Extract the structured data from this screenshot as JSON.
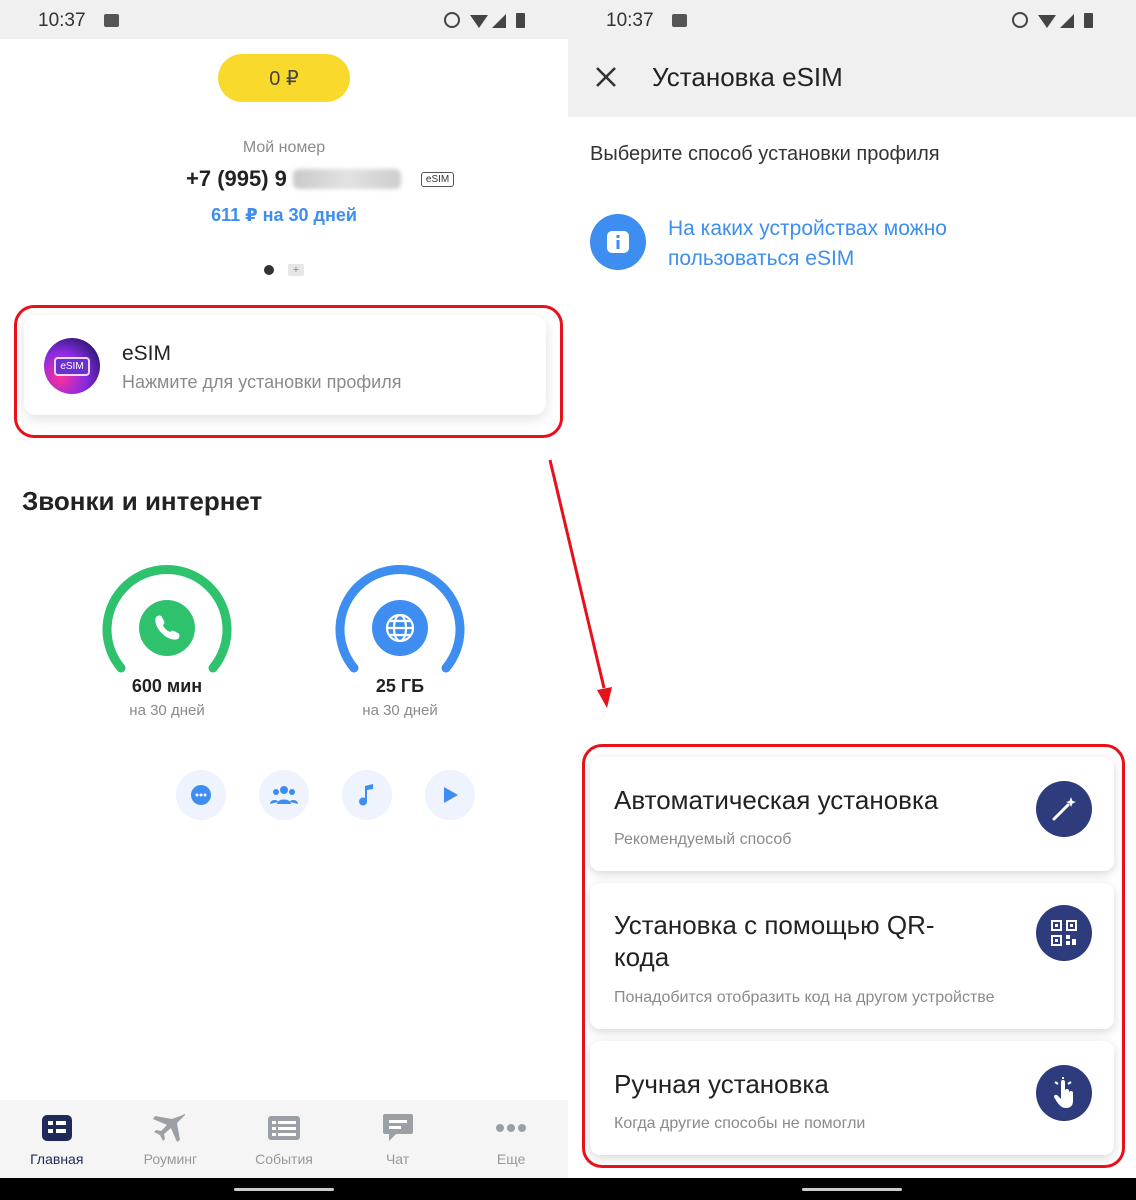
{
  "left": {
    "status": {
      "time": "10:37"
    },
    "balance": "0 ₽",
    "my_number_label": "Мой номер",
    "phone_visible": "+7 (995) 9",
    "esim_chip": "eSIM",
    "tariff": "611 ₽ на 30 дней",
    "esim_card": {
      "logo_text": "eSIM",
      "title": "eSIM",
      "subtitle": "Нажмите для установки профиля"
    },
    "section_title": "Звонки и интернет",
    "gauges": [
      {
        "value": "600 мин",
        "sub": "на 30 дней",
        "color": "#2dc26b",
        "icon": "phone-icon"
      },
      {
        "value": "25 ГБ",
        "sub": "на 30 дней",
        "color": "#3d8ef0",
        "icon": "globe-icon"
      }
    ],
    "services": [
      "chat-bubble-icon",
      "group-icon",
      "music-note-icon",
      "play-icon"
    ],
    "nav": [
      {
        "label": "Главная",
        "icon": "home-dashboard-icon",
        "active": true
      },
      {
        "label": "Роуминг",
        "icon": "airplane-icon",
        "active": false
      },
      {
        "label": "События",
        "icon": "list-icon",
        "active": false
      },
      {
        "label": "Чат",
        "icon": "chat-icon",
        "active": false
      },
      {
        "label": "Еще",
        "icon": "more-dots-icon",
        "active": false
      }
    ]
  },
  "right": {
    "status": {
      "time": "10:37"
    },
    "title": "Установка eSIM",
    "choose_method": "Выберите способ установки профиля",
    "info_link": "На каких устройствах можно пользоваться eSIM",
    "options": [
      {
        "title": "Автоматическая установка",
        "subtitle": "Рекомендуемый способ",
        "icon": "magic-wand-icon"
      },
      {
        "title": "Установка с помощью QR-кода",
        "subtitle": "Понадобится отобразить код на другом устройстве",
        "icon": "qr-code-icon"
      },
      {
        "title": "Ручная установка",
        "subtitle": "Когда другие способы не помогли",
        "icon": "tap-hand-icon"
      }
    ]
  },
  "colors": {
    "balance_pill": "#f9da2c",
    "accent_blue": "#3d8ef0",
    "accent_green": "#2dc26b",
    "option_icon_bg": "#2e3b7d",
    "highlight_red": "#e8101a"
  }
}
